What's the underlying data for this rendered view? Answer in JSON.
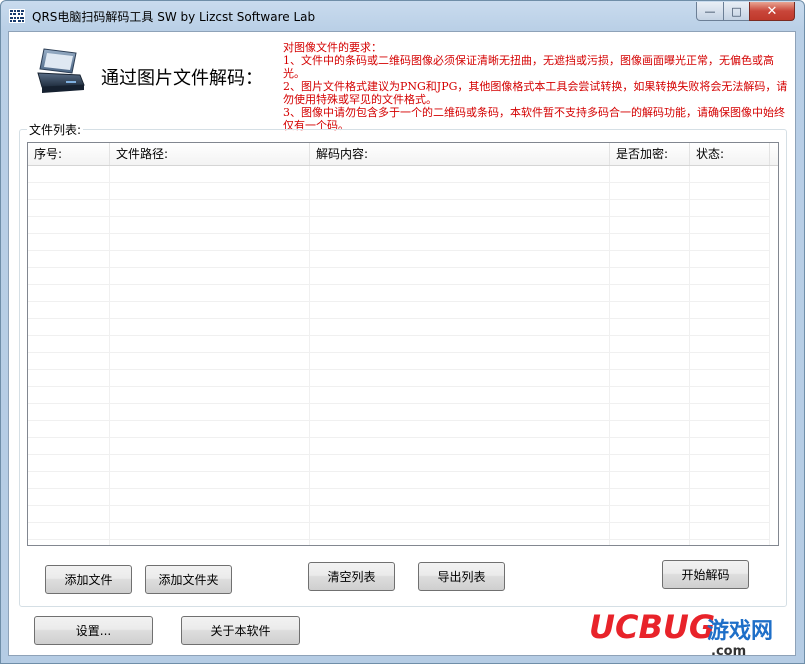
{
  "window": {
    "title": "QRS电脑扫码解码工具 SW  by Lizcst Software Lab",
    "icon_text": "QRS",
    "controls": {
      "minimize": "—",
      "maximize": "□",
      "close": "✕"
    }
  },
  "header": {
    "heading": "通过图片文件解码："
  },
  "requirements": {
    "title": "对图像文件的要求：",
    "lines": [
      "1、文件中的条码或二维码图像必须保证清晰无扭曲，无遮挡或污损，图像画面曝光正常，无偏色或高光。",
      "2、图片文件格式建议为PNG和JPG，其他图像格式本工具会尝试转换，如果转换失败将会无法解码，请勿使用特殊或罕见的文件格式。",
      "3、图像中请勿包含多于一个的二维码或条码，本软件暂不支持多码合一的解码功能，请确保图像中始终仅有一个码。"
    ]
  },
  "file_list": {
    "label": "文件列表:",
    "columns": [
      "序号:",
      "文件路径:",
      "解码内容:",
      "是否加密:",
      "状态:"
    ],
    "rows": []
  },
  "buttons": {
    "add_file": "添加文件",
    "add_folder": "添加文件夹",
    "clear_list": "清空列表",
    "export_list": "导出列表",
    "start_decode": "开始解码",
    "settings": "设置...",
    "about": "关于本软件"
  },
  "watermark": {
    "brand": "UCBUG",
    "suffix": "游戏网",
    "domain": ".com"
  },
  "colors": {
    "requirements_text": "#d40000",
    "watermark_red": "#e8232a",
    "watermark_blue": "#1e6fc8"
  }
}
